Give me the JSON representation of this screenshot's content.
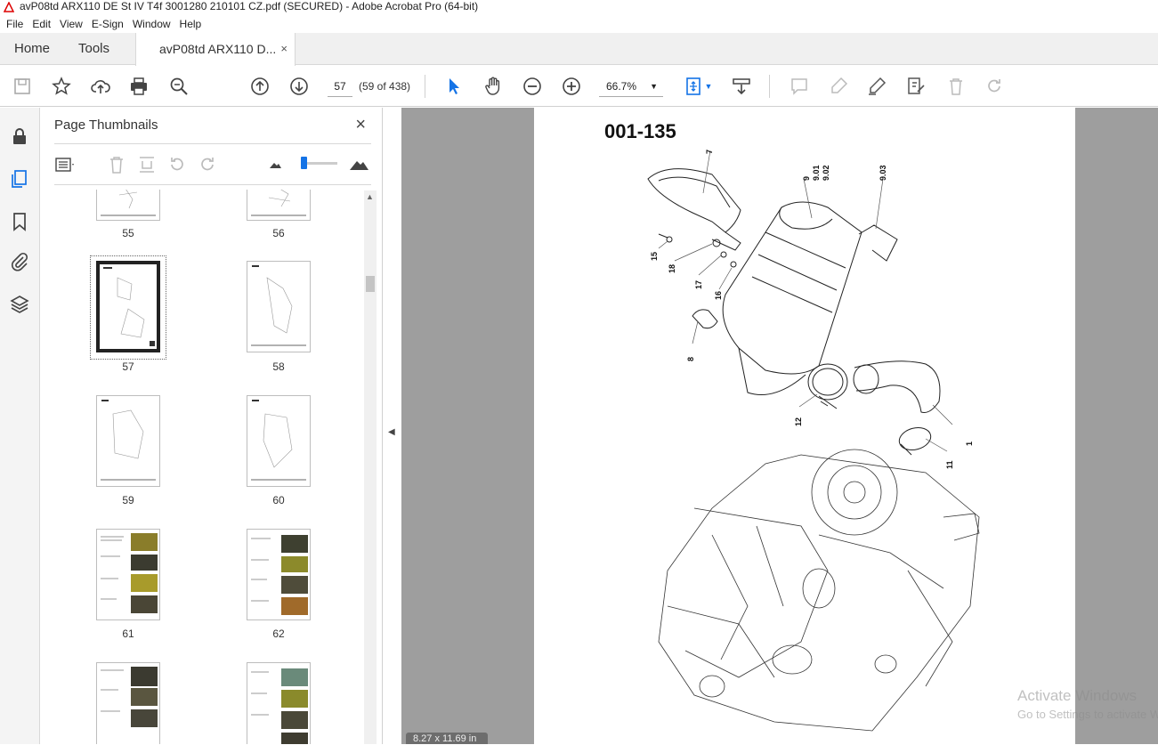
{
  "window": {
    "title": "avP08td ARX110 DE St IV T4f 3001280 210101 CZ.pdf (SECURED) - Adobe Acrobat Pro (64-bit)"
  },
  "menu": [
    "File",
    "Edit",
    "View",
    "E-Sign",
    "Window",
    "Help"
  ],
  "tabs": {
    "home": "Home",
    "tools": "Tools",
    "document": "avP08td ARX110 D...",
    "close": "×"
  },
  "toolbar": {
    "current_page": "57",
    "page_count": "(59 of 438)",
    "zoom": "66.7%"
  },
  "panel": {
    "title": "Page Thumbnails",
    "close": "×",
    "thumbnails": [
      {
        "label": "55"
      },
      {
        "label": "56"
      },
      {
        "label": "57",
        "selected": true
      },
      {
        "label": "58"
      },
      {
        "label": "59"
      },
      {
        "label": "60"
      },
      {
        "label": "61"
      },
      {
        "label": "62"
      },
      {
        "label": ""
      },
      {
        "label": ""
      }
    ]
  },
  "document": {
    "heading": "001-135",
    "callouts": [
      "7",
      "9",
      "9.01",
      "9.02",
      "9.03",
      "15",
      "18",
      "17",
      "16",
      "8",
      "12",
      "1",
      "11"
    ]
  },
  "status": {
    "page_size": "8.27 x 11.69 in"
  },
  "overlay": {
    "line1": "Activate Windows",
    "line2": "Go to Settings to activate Windows."
  },
  "colors": {
    "accent": "#1473e6",
    "viewer_bg": "#9e9e9e"
  }
}
